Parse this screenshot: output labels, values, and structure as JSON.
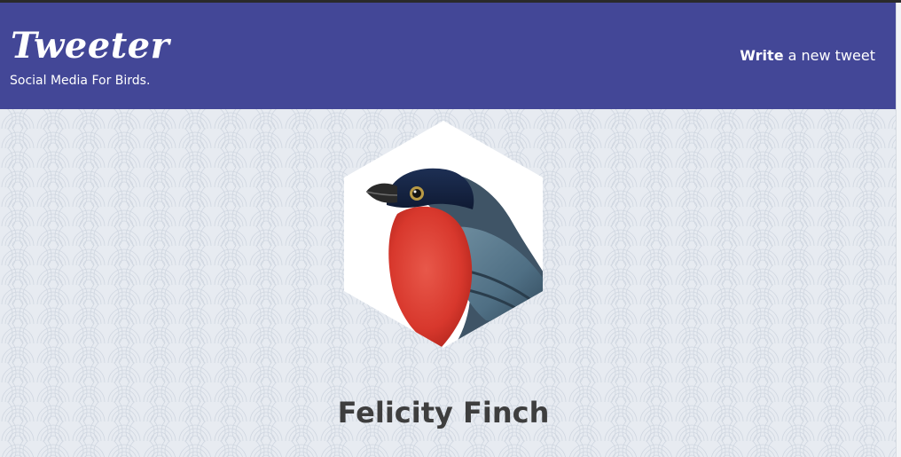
{
  "header": {
    "logo": "Tweeter",
    "tagline": "Social Media For Birds.",
    "write_bold": "Write",
    "write_rest": " a new tweet"
  },
  "profile": {
    "name": "Felicity Finch",
    "avatar_icon": "bullfinch-bird-image"
  },
  "colors": {
    "header_bg": "#434797",
    "page_bg": "#e7ebf1",
    "name_text": "#3e3e3e"
  }
}
